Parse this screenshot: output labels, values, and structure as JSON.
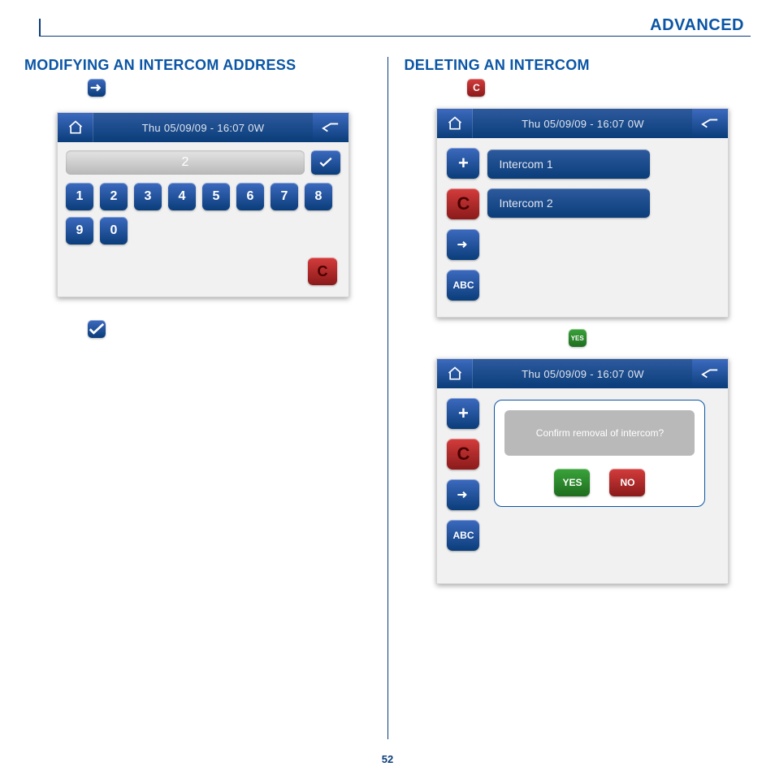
{
  "header": {
    "section": "ADVANCED"
  },
  "pageNumber": "52",
  "left": {
    "title": "MODIFYING AN INTERCOM ADDRESS",
    "statusbar": "Thu 05/09/09 - 16:07   0W",
    "inputValue": "2",
    "keypad": [
      "1",
      "2",
      "3",
      "4",
      "5",
      "6",
      "7",
      "8",
      "9",
      "0"
    ],
    "clearLabel": "C"
  },
  "right": {
    "title": "DELETING AN INTERCOM",
    "statusbar": "Thu 05/09/09 - 16:07   0W",
    "sideButtons": {
      "add": "+",
      "clear": "C",
      "abc": "ABC"
    },
    "items": [
      "Intercom 1",
      "Intercom 2"
    ],
    "dialog": {
      "message": "Confirm removal of intercom?",
      "yes": "YES",
      "no": "NO"
    },
    "yesIcon": "YES"
  }
}
